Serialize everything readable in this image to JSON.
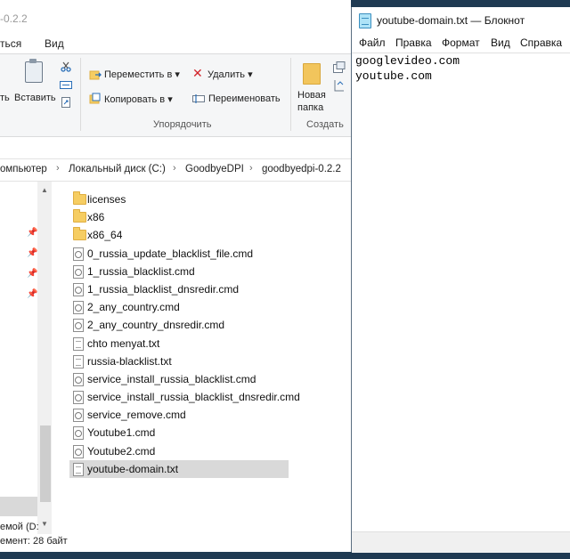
{
  "explorer": {
    "title": "-0.2.2",
    "menu": {
      "tab_file_partial": "ться",
      "tab_view": "Вид"
    },
    "ribbon": {
      "paste_partial": "ть",
      "paste_label": "Вставить",
      "move_to": "Переместить в",
      "copy_to": "Копировать в",
      "delete": "Удалить",
      "rename": "Переименовать",
      "new_folder_line1": "Новая",
      "new_folder_line2": "папка",
      "group_organize": "Упорядочить",
      "group_create": "Создать"
    },
    "breadcrumb": [
      "омпьютер",
      "Локальный диск (C:)",
      "GoodbyeDPI",
      "goodbyedpi-0.2.2"
    ],
    "navpane": {
      "drive_partial": "емой (D:"
    },
    "files": [
      {
        "name": "licenses",
        "type": "folder"
      },
      {
        "name": "x86",
        "type": "folder"
      },
      {
        "name": "x86_64",
        "type": "folder"
      },
      {
        "name": "0_russia_update_blacklist_file.cmd",
        "type": "cmd"
      },
      {
        "name": "1_russia_blacklist.cmd",
        "type": "cmd"
      },
      {
        "name": "1_russia_blacklist_dnsredir.cmd",
        "type": "cmd"
      },
      {
        "name": "2_any_country.cmd",
        "type": "cmd"
      },
      {
        "name": "2_any_country_dnsredir.cmd",
        "type": "cmd"
      },
      {
        "name": "chto menyat.txt",
        "type": "txt"
      },
      {
        "name": "russia-blacklist.txt",
        "type": "txt"
      },
      {
        "name": "service_install_russia_blacklist.cmd",
        "type": "cmd"
      },
      {
        "name": "service_install_russia_blacklist_dnsredir.cmd",
        "type": "cmd"
      },
      {
        "name": "service_remove.cmd",
        "type": "cmd"
      },
      {
        "name": "Youtube1.cmd",
        "type": "cmd"
      },
      {
        "name": "Youtube2.cmd",
        "type": "cmd"
      },
      {
        "name": "youtube-domain.txt",
        "type": "txt",
        "selected": true
      }
    ],
    "status": "емент: 28 байт"
  },
  "notepad": {
    "title": "youtube-domain.txt — Блокнот",
    "menu": [
      "Файл",
      "Правка",
      "Формат",
      "Вид",
      "Справка"
    ],
    "lines": [
      "googlevideo.com",
      "youtube.com"
    ]
  },
  "colors": {
    "desktop": "#1f3a52",
    "selection": "#d9d9d9",
    "folder": "#f6cd62"
  }
}
